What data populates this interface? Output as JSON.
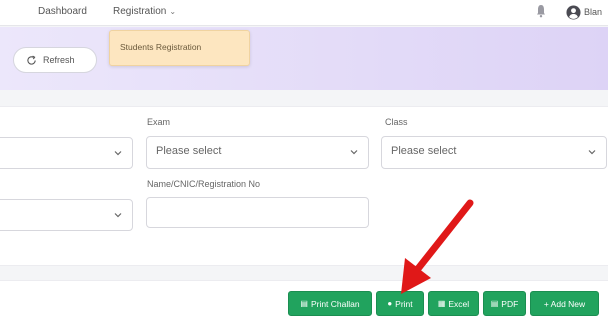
{
  "nav": {
    "dashboard": "Dashboard",
    "registration": "Registration",
    "registration_caret": "⌄",
    "user_name": "Blan"
  },
  "dropdown": {
    "items": [
      "Students Registration"
    ]
  },
  "toolbar": {
    "refresh_label": "Refresh"
  },
  "filters": {
    "exam": {
      "label": "Exam",
      "placeholder": "Please select"
    },
    "class": {
      "label": "Class",
      "placeholder": "Please select"
    },
    "search": {
      "label": "Name/CNIC/Registration No",
      "value": ""
    }
  },
  "actions": {
    "print_challan": "Print Challan",
    "print": "Print",
    "excel": "Excel",
    "pdf": "PDF",
    "add_new": "+ Add New"
  },
  "colors": {
    "accent_green": "#21a35e",
    "header_purple": "#ddd3f6",
    "dropdown_bg": "#fde6c0",
    "annotation_red": "#e01818"
  },
  "icons": {
    "bell": "bell-icon",
    "user": "user-circle-icon",
    "refresh": "refresh-icon",
    "chevron": "chevron-down-icon",
    "print_challan": "document-icon",
    "print": "print-icon",
    "excel": "excel-icon",
    "pdf": "pdf-icon",
    "annotation": "red-arrow-annotation"
  }
}
